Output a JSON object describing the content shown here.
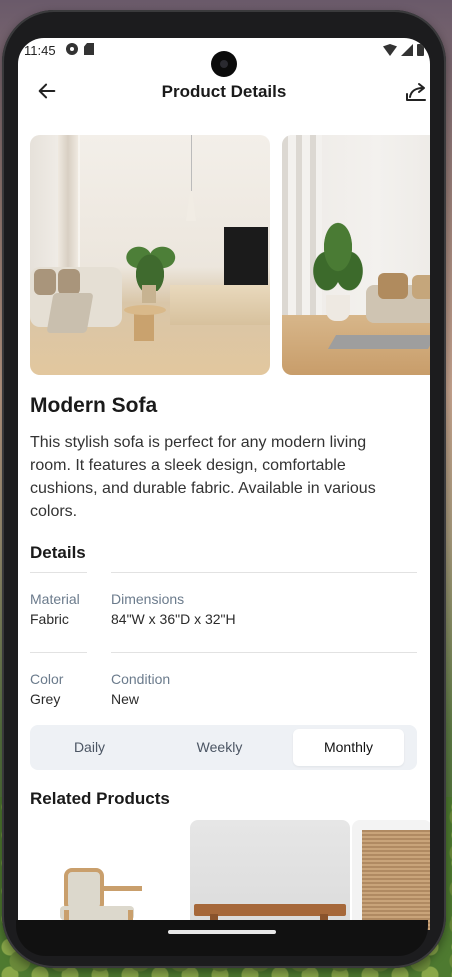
{
  "status_bar": {
    "time": "11:45"
  },
  "header": {
    "title": "Product Details"
  },
  "product": {
    "name": "Modern Sofa",
    "description": "This stylish sofa is perfect for any modern living room. It features a sleek design, comfortable cushions, and durable fabric. Available in various colors."
  },
  "details": {
    "heading": "Details",
    "material_label": "Material",
    "material_value": "Fabric",
    "dimensions_label": "Dimensions",
    "dimensions_value": "84\"W x 36\"D x 32\"H",
    "color_label": "Color",
    "color_value": "Grey",
    "condition_label": "Condition",
    "condition_value": "New"
  },
  "period_toggle": {
    "options": [
      "Daily",
      "Weekly",
      "Monthly"
    ],
    "selected": "Monthly"
  },
  "related": {
    "heading": "Related Products"
  },
  "icons": {
    "back": "arrow-left-icon",
    "share": "share-icon"
  },
  "colors": {
    "accent_text": "#1a1a1a",
    "label_text": "#6b7b8c",
    "toggle_bg": "#eef1f5"
  }
}
